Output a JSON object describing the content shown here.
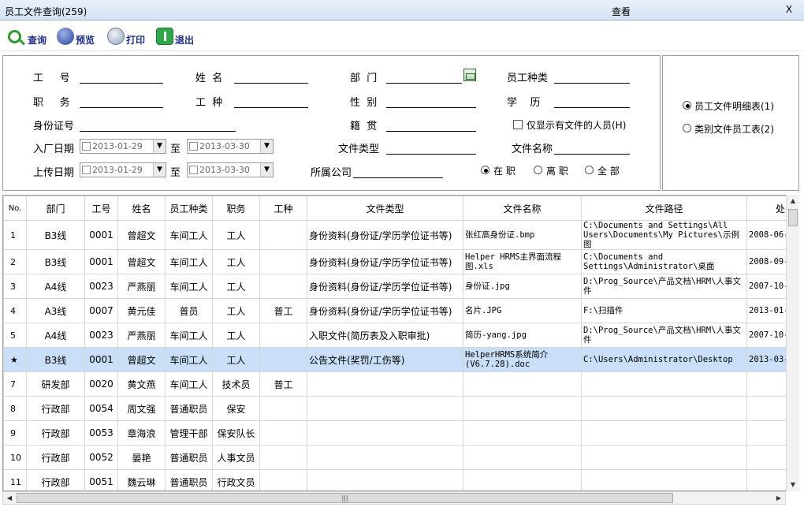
{
  "window": {
    "title": "员工文件查询(259)",
    "mode": "查看",
    "close": "X"
  },
  "toolbar": {
    "query": "查询",
    "preview": "预览",
    "print": "打印",
    "exit": "退出"
  },
  "filter": {
    "emp_no": "工  号",
    "name": "姓  名",
    "dept": "部  门",
    "emp_type": "员工种类",
    "position": "职  务",
    "work_type": "工  种",
    "gender": "性  别",
    "education": "学  历",
    "id_card": "身份证号",
    "native": "籍  贯",
    "only_with_files": "仅显示有文件的人员(H)",
    "hire_date": "入厂日期",
    "hire_from": "2013-01-29",
    "to1": "至",
    "hire_to": "2013-03-30",
    "file_type": "文件类型",
    "file_name": "文件名称",
    "upload_date": "上传日期",
    "upload_from": "2013-01-29",
    "to2": "至",
    "upload_to": "2013-03-30",
    "company": "所属公司",
    "status_active": "在 职",
    "status_left": "离 职",
    "status_all": "全 部"
  },
  "report": {
    "opt1": "员工文件明细表(1)",
    "opt2": "类别文件员工表(2)"
  },
  "table": {
    "headers": [
      "No.",
      "部门",
      "工号",
      "姓名",
      "员工种类",
      "职务",
      "工种",
      "文件类型",
      "文件名称",
      "文件路径",
      "处"
    ],
    "rows": [
      [
        "1",
        "B3线",
        "0001",
        "曾超文",
        "车间工人",
        "工人",
        "",
        "身份资料(身份证/学历学位证书等)",
        "张红高身份证.bmp",
        "C:\\Documents and Settings\\All Users\\Documents\\My Pictures\\示例图",
        "2008-06-"
      ],
      [
        "2",
        "B3线",
        "0001",
        "曾超文",
        "车间工人",
        "工人",
        "",
        "身份资料(身份证/学历学位证书等)",
        "Helper HRMS主界面流程图.xls",
        "C:\\Documents and Settings\\Administrator\\桌面",
        "2008-09-"
      ],
      [
        "3",
        "A4线",
        "0023",
        "严燕丽",
        "车间工人",
        "工人",
        "",
        "身份资料(身份证/学历学位证书等)",
        "身份证.jpg",
        "D:\\Prog_Source\\产品文档\\HRM\\人事文件",
        "2007-10-"
      ],
      [
        "4",
        "A3线",
        "0007",
        "黄元佳",
        "普员",
        "工人",
        "普工",
        "身份资料(身份证/学历学位证书等)",
        "名片.JPG",
        "F:\\扫描件",
        "2013-01-"
      ],
      [
        "5",
        "A4线",
        "0023",
        "严燕丽",
        "车间工人",
        "工人",
        "",
        "入职文件(简历表及入职审批)",
        "简历-yang.jpg",
        "D:\\Prog_Source\\产品文档\\HRM\\人事文件",
        "2007-10-"
      ],
      [
        "★",
        "B3线",
        "0001",
        "曾超文",
        "车间工人",
        "工人",
        "",
        "公告文件(奖罚/工伤等)",
        "HelperHRMS系统简介(V6.7.28).doc",
        "C:\\Users\\Administrator\\Desktop",
        "2013-03-"
      ],
      [
        "7",
        "研发部",
        "0020",
        "黄文燕",
        "车间工人",
        "技术员",
        "普工",
        "",
        "",
        "",
        ""
      ],
      [
        "8",
        "行政部",
        "0054",
        "周文强",
        "普通职员",
        "保安",
        "",
        "",
        "",
        "",
        ""
      ],
      [
        "9",
        "行政部",
        "0053",
        "章海浪",
        "管理干部",
        "保安队长",
        "",
        "",
        "",
        "",
        ""
      ],
      [
        "10",
        "行政部",
        "0052",
        "晏艳",
        "普通职员",
        "人事文员",
        "",
        "",
        "",
        "",
        ""
      ],
      [
        "11",
        "行政部",
        "0051",
        "魏云琳",
        "普通职员",
        "行政文员",
        "",
        "",
        "",
        "",
        ""
      ]
    ]
  },
  "colors": {
    "selected_row": "#c9def7",
    "toolbar_text": "#1c2e8c",
    "titlebar": "#d3e2f3"
  },
  "icons": [
    "search-icon",
    "preview-icon",
    "print-icon",
    "exit-icon",
    "calendar-icon"
  ]
}
